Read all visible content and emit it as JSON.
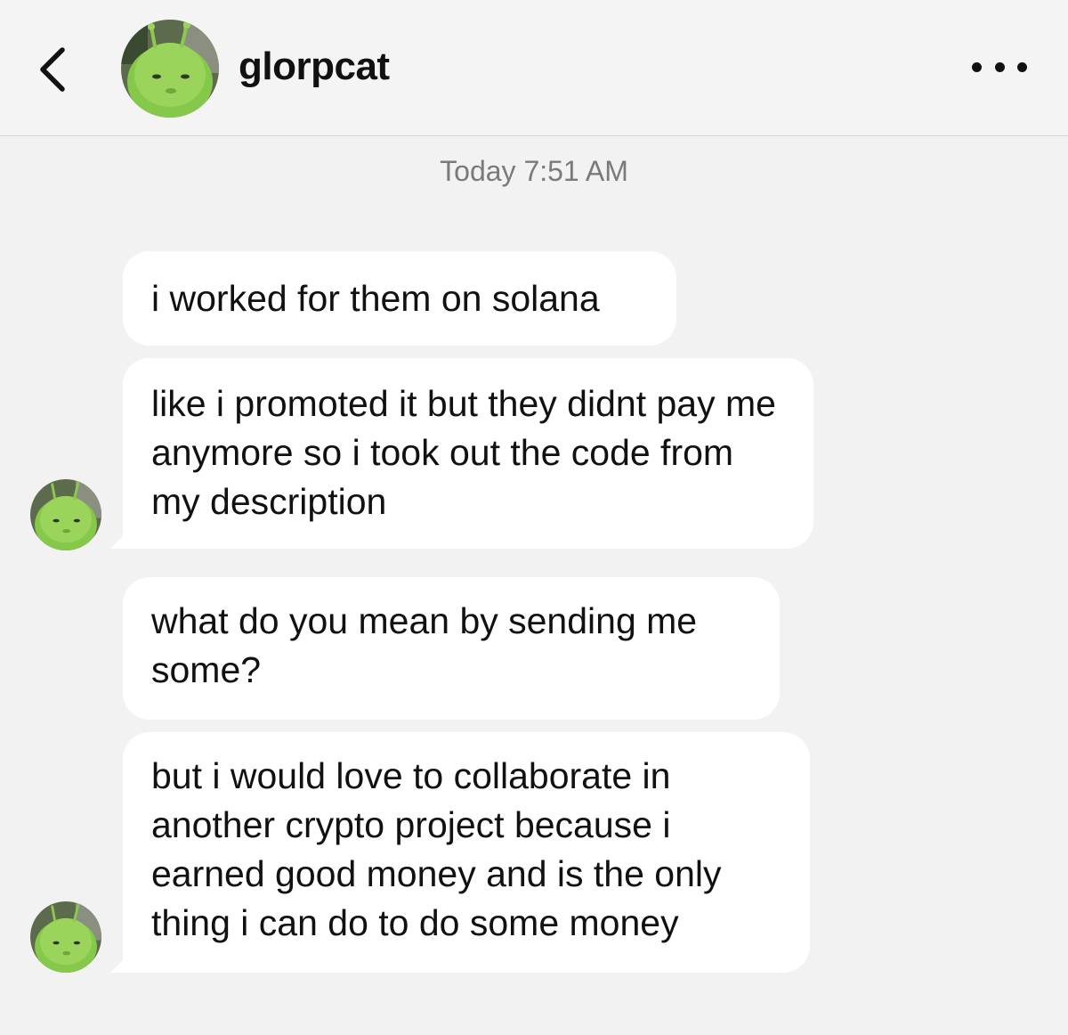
{
  "header": {
    "username": "glorpcat",
    "back_icon": "chevron-left-icon",
    "more_icon": "more-horizontal-icon"
  },
  "thread": {
    "timestamp": "Today 7:51 AM",
    "messages": [
      {
        "text": "i worked for them on solana",
        "from": "glorpcat",
        "avatar_shown": false
      },
      {
        "text": "like i promoted it but they didnt pay me anymore so i took out the code from my description",
        "from": "glorpcat",
        "avatar_shown": true
      },
      {
        "text": "what do you mean by sending me some?",
        "from": "glorpcat",
        "avatar_shown": false
      },
      {
        "text": "but i would love to collaborate in another crypto project because i earned good money and is the only thing i can do to do some money",
        "from": "glorpcat",
        "avatar_shown": true
      }
    ]
  },
  "colors": {
    "background": "#f2f2f2",
    "bubble": "#ffffff",
    "avatar_green": "#8fd14a",
    "timestamp": "#7a7a7a"
  }
}
